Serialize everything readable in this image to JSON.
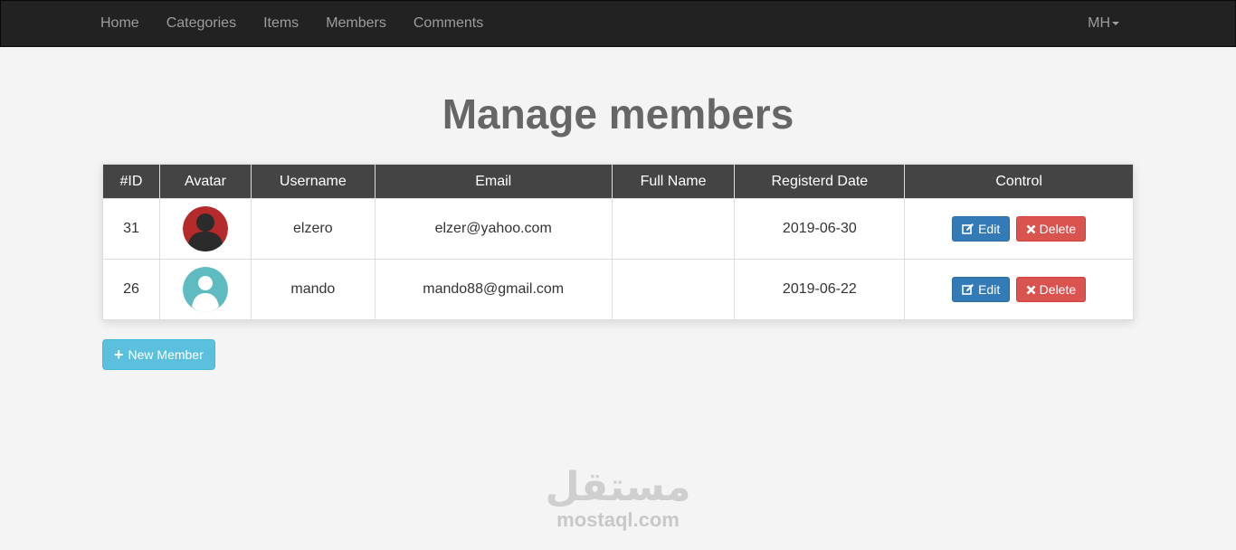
{
  "nav": {
    "links": [
      "Home",
      "Categories",
      "Items",
      "Members",
      "Comments"
    ],
    "user": "MH"
  },
  "page": {
    "title": "Manage members"
  },
  "table": {
    "headers": [
      "#ID",
      "Avatar",
      "Username",
      "Email",
      "Full Name",
      "Registerd Date",
      "Control"
    ],
    "rows": [
      {
        "id": "31",
        "avatar": "dark-user-avatar",
        "avatar_color": "#b52a2a",
        "username": "elzero",
        "email": "elzer@yahoo.com",
        "full_name": "",
        "date": "2019-06-30"
      },
      {
        "id": "26",
        "avatar": "teal-user-avatar",
        "avatar_color": "#5ebcc0",
        "username": "mando",
        "email": "mando88@gmail.com",
        "full_name": "",
        "date": "2019-06-22"
      }
    ],
    "edit_label": "Edit",
    "delete_label": "Delete"
  },
  "actions": {
    "new_member_label": "New Member"
  },
  "watermark": {
    "arabic": "مستقل",
    "latin": "mostaql.com"
  },
  "colors": {
    "navbar": "#222222",
    "table_header": "#444444",
    "edit": "#337ab7",
    "delete": "#d9534f",
    "new": "#5bc0de"
  }
}
